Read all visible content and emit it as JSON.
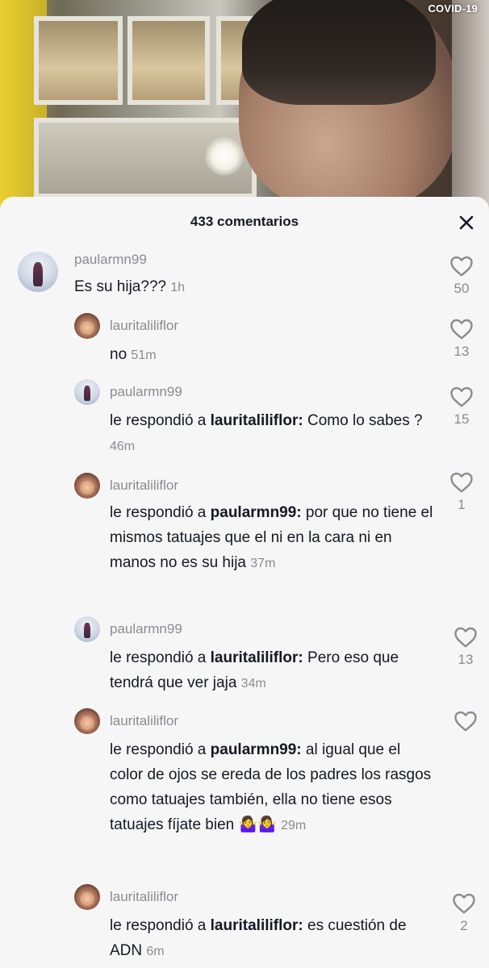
{
  "video": {
    "badge": "COVID-19"
  },
  "sheet": {
    "title": "433 comentarios",
    "close_icon": "close-icon"
  },
  "comments": [
    {
      "user": "paularmn99",
      "parts": {
        "text": "Es su hija???"
      },
      "time": "1h",
      "likes": "50"
    },
    {
      "user": "lauritaliliflor",
      "parts": {
        "text": "no"
      },
      "time": "51m",
      "likes": "13"
    },
    {
      "user": "paularmn99",
      "prefix": "le respondió a",
      "mention": "lauritaliliflor:",
      "parts": {
        "text": "Como lo sabes ?"
      },
      "time": "46m",
      "likes": "15"
    },
    {
      "user": "lauritaliliflor",
      "prefix": "le respondió a",
      "mention": "paularmn99:",
      "parts": {
        "text": "por que no tiene el mismos tatuajes que el ni en la cara ni en manos no es su hija"
      },
      "time": "37m",
      "likes": "1"
    },
    {
      "user": "paularmn99",
      "prefix": "le respondió a",
      "mention": "lauritaliliflor:",
      "parts": {
        "text": "Pero eso que tendrá que ver jaja"
      },
      "time": "34m",
      "likes": "13"
    },
    {
      "user": "lauritaliliflor",
      "prefix": "le respondió a",
      "mention": "paularmn99:",
      "parts": {
        "text": "al igual que el color de ojos se ereda de los padres los rasgos como tatuajes también, ella no tiene esos tatuajes fíjate bien"
      },
      "emoji": "🤷‍♀️🤷‍♀️",
      "time": "29m",
      "likes": ""
    },
    {
      "user": "lauritaliliflor",
      "prefix": "le respondió a",
      "mention": "lauritaliliflor:",
      "parts": {
        "text": "es cuestión de ADN"
      },
      "time": "6m",
      "likes": "2"
    }
  ],
  "icons": {
    "like": "heart-outline-icon",
    "close": "close-icon"
  },
  "colors": {
    "sheet_bg": "#f6f6f6",
    "username": "#8a8b91",
    "text": "#161823"
  }
}
